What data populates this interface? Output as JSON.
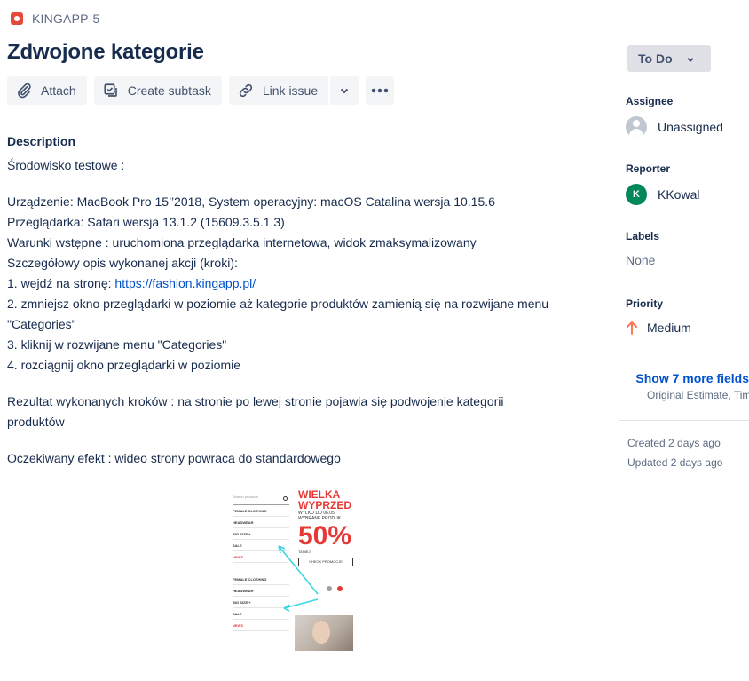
{
  "breadcrumb": {
    "issue_key": "KINGAPP-5",
    "icon": "bug-icon",
    "icon_color": "#e5493a"
  },
  "issue": {
    "title": "Zdwojone kategorie"
  },
  "toolbar": {
    "attach_label": "Attach",
    "create_subtask_label": "Create subtask",
    "link_issue_label": "Link issue"
  },
  "description": {
    "heading": "Description",
    "lines": {
      "env": "Środowisko testowe :",
      "device": "Urządzenie: MacBook Pro 15’’2018, System operacyjny: macOS Catalina wersja 10.15.6",
      "browser": "Przeglądarka: Safari wersja 13.1.2 (15609.3.5.1.3)",
      "preconditions": "Warunki wstępne : uruchomiona przeglądarka internetowa, widok zmaksymalizowany",
      "steps_intro": "Szczegółowy opis wykonanej akcji (kroki):",
      "step1_prefix": "1. wejdź na stronę: ",
      "step1_link": "https://fashion.kingapp.pl/",
      "step2": "2. zmniejsz okno przeglądarki w poziomie aż kategorie produktów zamienią się na rozwijane menu \"Categories\"",
      "step3": "3. kliknij w rozwijane menu \"Categories\"",
      "step4": "4. rozciągnij okno przeglądarki w poziomie",
      "result": "Rezultat wykonanych kroków : na stronie po lewej stronie pojawia się podwojenie kategorii produktów",
      "expected": "Oczekiwany efekt : wideo strony powraca do standardowego"
    }
  },
  "attachment_image": {
    "search_placeholder": "Search products",
    "list_a": [
      "FEMALE CLOTHING",
      "HEADWEAR",
      "BIG SIZE +",
      "SALE",
      "NEWS"
    ],
    "list_b": [
      "FEMALE CLOTHING",
      "HEADWEAR",
      "BIG SIZE +",
      "SALE",
      "NEWS"
    ],
    "promo_title_1": "WIELKA",
    "promo_title_2": "WYPRZED",
    "promo_sub_1": "WYLKO DO 06.05",
    "promo_sub_2": "WYBRANE PRODUK",
    "promo_percent": "50%",
    "promo_tiny": "TANIEJ*",
    "promo_button": "CHECK PROMOCJE",
    "accent_color": "#e53935",
    "arrow_color": "#3dd6e0"
  },
  "sidebar": {
    "status": "To Do",
    "assignee": {
      "label": "Assignee",
      "value": "Unassigned"
    },
    "reporter": {
      "label": "Reporter",
      "value": "KKowal",
      "initial": "K",
      "avatar_color": "#00875a"
    },
    "labels": {
      "label": "Labels",
      "value": "None"
    },
    "priority": {
      "label": "Priority",
      "value": "Medium",
      "icon": "arrow-up-icon",
      "color": "#ff7452"
    },
    "more_fields": {
      "link": "Show 7 more fields",
      "sub": "Original Estimate, Time tracking"
    },
    "created": "Created 2 days ago",
    "updated": "Updated 2 days ago"
  }
}
